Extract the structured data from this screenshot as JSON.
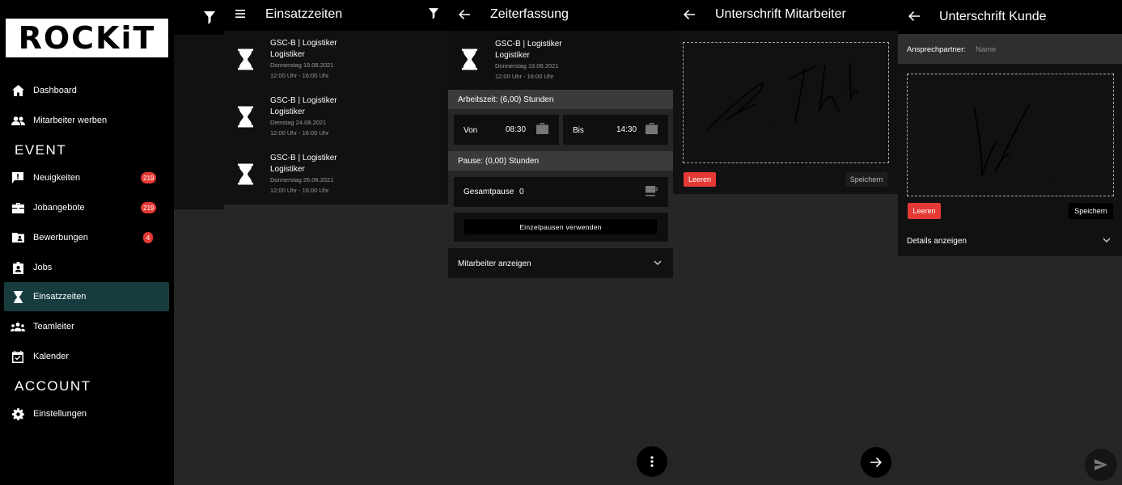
{
  "drawer": {
    "logo": "ROCKiT",
    "items": [
      {
        "label": "Dashboard",
        "icon": "home-icon"
      },
      {
        "label": "Mitarbeiter werben",
        "icon": "people-icon"
      },
      {
        "label": "Neuigkeiten",
        "icon": "announcement-icon",
        "badge": "219"
      },
      {
        "label": "Jobangebote",
        "icon": "briefcase-icon",
        "badge": "219"
      },
      {
        "label": "Bewerbungen",
        "icon": "folder-account-icon",
        "badge": "4"
      },
      {
        "label": "Jobs",
        "icon": "badge-icon"
      },
      {
        "label": "Einsatzzeiten",
        "icon": "hourglass-icon",
        "active": true
      },
      {
        "label": "Teamleiter",
        "icon": "group-icon"
      },
      {
        "label": "Kalender",
        "icon": "calendar-check-icon"
      },
      {
        "label": "Einstellungen",
        "icon": "gear-icon"
      }
    ],
    "sections": {
      "event": "EVENT",
      "account": "ACCOUNT"
    }
  },
  "einsatzzeiten": {
    "title": "Einsatzzeiten",
    "shifts": [
      {
        "company": "GSC-B | Logistiker",
        "role": "Logistiker",
        "date": "Donnerstag 19.08.2021",
        "time": "12:00 Uhr - 16:00 Uhr"
      },
      {
        "company": "GSC-B | Logistiker",
        "role": "Logistiker",
        "date": "Dienstag 24.08.2021",
        "time": "12:00 Uhr - 16:00 Uhr"
      },
      {
        "company": "GSC-B | Logistiker",
        "role": "Logistiker",
        "date": "Donnerstag 26.08.2021",
        "time": "12:00 Uhr - 16:00 Uhr"
      }
    ]
  },
  "zeiterfassung": {
    "title": "Zeiterfassung",
    "shift": {
      "company": "GSC-B | Logistiker",
      "role": "Logistiker",
      "date": "Donnerstag 19.08.2021",
      "time": "12:00 Uhr - 16:00 Uhr"
    },
    "arbeitszeit": "Arbeitszeit: (6,00) Stunden",
    "von_label": "Von",
    "von_value": "08:30",
    "bis_label": "Bis",
    "bis_value": "14:30",
    "pause_header": "Pause: (0,00) Stunden",
    "gesamtpause_label": "Gesamtpause",
    "gesamtpause_value": "0",
    "einzelpausen_button": "Einzelpausen verwenden",
    "mitarbeiter_anzeigen": "Mitarbeiter anzeigen"
  },
  "unterschrift_mitarbeiter": {
    "title": "Unterschrift Mitarbeiter",
    "leeren": "Leeren",
    "speichern": "Speichern"
  },
  "unterschrift_kunde": {
    "title": "Unterschrift Kunde",
    "ansprechpartner_label": "Ansprechpartner:",
    "ansprechpartner_placeholder": "Name",
    "leeren": "Leeren",
    "speichern": "Speichern",
    "details": "Details anzeigen"
  },
  "colors": {
    "accent_red": "#e53935",
    "active_bg": "#173c3f",
    "panel_bg": "#262626"
  }
}
